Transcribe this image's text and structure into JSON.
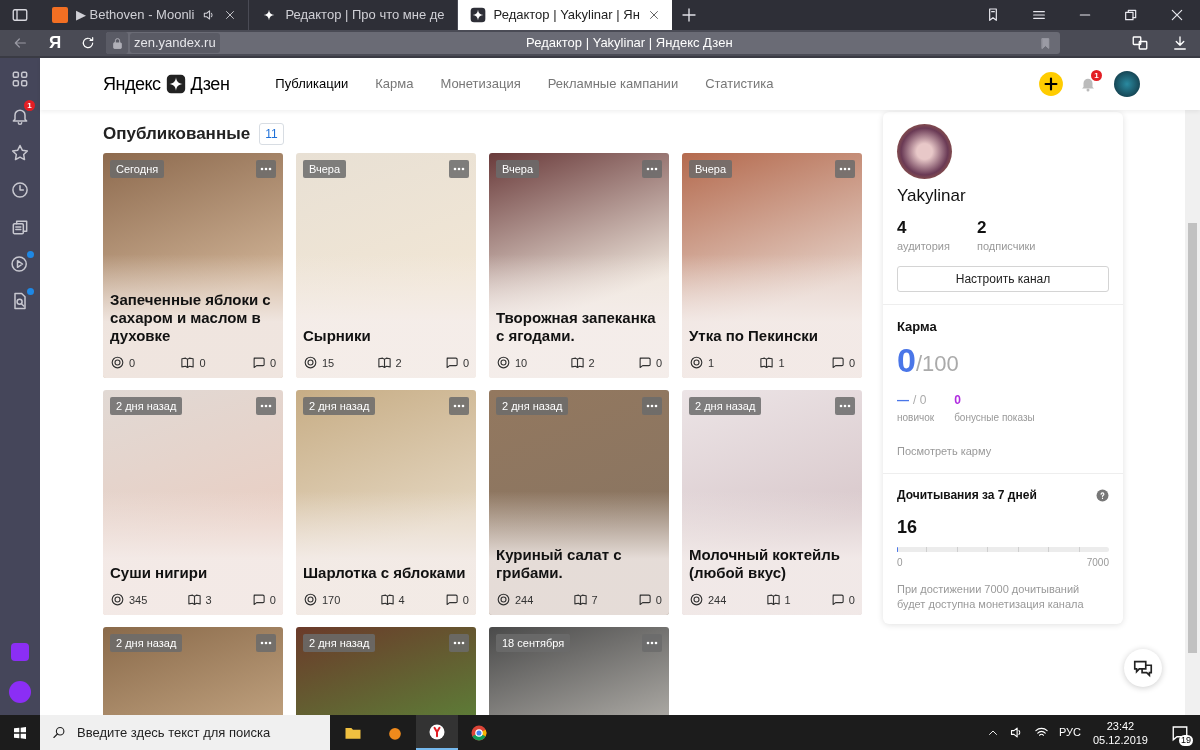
{
  "browser": {
    "tabs": [
      {
        "kind": "audio",
        "title": "▶ Bethoven - Moonli",
        "selected": false
      },
      {
        "kind": "zen",
        "title": "Редактор | Про что мне де",
        "selected": false
      },
      {
        "kind": "zen",
        "title": "Редактор | Yakylinar | Ян",
        "selected": true
      }
    ],
    "address": "zen.yandex.ru",
    "page_title": "Редактор | Yakylinar | Яндекс Дзен",
    "yandex_button": "Я"
  },
  "sidebar": {
    "items": [
      {
        "kind": "grid",
        "dot": false
      },
      {
        "kind": "bell",
        "badge": "1",
        "dot": false
      },
      {
        "kind": "star",
        "dot": false
      },
      {
        "kind": "clock",
        "dot": false
      },
      {
        "kind": "cards",
        "dot": false
      },
      {
        "kind": "play",
        "dot": true
      },
      {
        "kind": "search-doc",
        "dot": true
      }
    ]
  },
  "header": {
    "logo_left": "Яндекс",
    "logo_right": "Дзен",
    "nav": [
      {
        "label": "Публикации",
        "selected": true
      },
      {
        "label": "Карма",
        "selected": false
      },
      {
        "label": "Монетизация",
        "selected": false
      },
      {
        "label": "Рекламные кампании",
        "selected": false
      },
      {
        "label": "Статистика",
        "selected": false
      }
    ],
    "notification_count": "1"
  },
  "published": {
    "title": "Опубликованные",
    "count": "11",
    "cards": [
      {
        "date": "Сегодня",
        "title": "Запеченные яблоки с сахаром и маслом в духовке",
        "views": "0",
        "reads": "0",
        "comments": "0"
      },
      {
        "date": "Вчера",
        "title": "Сырники",
        "views": "15",
        "reads": "2",
        "comments": "0"
      },
      {
        "date": "Вчера",
        "title": "Творожная запеканка с ягодами.",
        "views": "10",
        "reads": "2",
        "comments": "0"
      },
      {
        "date": "Вчера",
        "title": "Утка по Пекински",
        "views": "1",
        "reads": "1",
        "comments": "0"
      },
      {
        "date": "2 дня назад",
        "title": "Суши нигири",
        "views": "345",
        "reads": "3",
        "comments": "0"
      },
      {
        "date": "2 дня назад",
        "title": "Шарлотка с яблоками",
        "views": "170",
        "reads": "4",
        "comments": "0"
      },
      {
        "date": "2 дня назад",
        "title": "Куриный салат с грибами.",
        "views": "244",
        "reads": "7",
        "comments": "0"
      },
      {
        "date": "2 дня назад",
        "title": "Молочный коктейль (любой вкус)",
        "views": "244",
        "reads": "1",
        "comments": "0"
      },
      {
        "date": "2 дня назад"
      },
      {
        "date": "2 дня назад"
      },
      {
        "date": "18 сентября"
      }
    ]
  },
  "profile": {
    "name": "Yakylinar",
    "stats": [
      {
        "value": "4",
        "label": "аудитория"
      },
      {
        "value": "2",
        "label": "подписчики"
      }
    ],
    "button": "Настроить канал"
  },
  "karma": {
    "title": "Карма",
    "value": "0",
    "max": "/100",
    "novice_value": "—",
    "novice_max": "/ 0",
    "novice_label": "новичок",
    "bonus_value": "0",
    "bonus_label": "бонусные показы",
    "link": "Посмотреть карму"
  },
  "reads": {
    "title": "Дочитывания за 7 дней",
    "value": "16",
    "level": 0.0023,
    "min": "0",
    "max": "7000",
    "note": "При достижении 7000 дочитываний будет доступна монетизация канала"
  },
  "taskbar": {
    "search_placeholder": "Введите здесь текст для поиска",
    "language": "РУС",
    "time": "23:42",
    "date": "05.12.2019",
    "notifications": "19"
  }
}
